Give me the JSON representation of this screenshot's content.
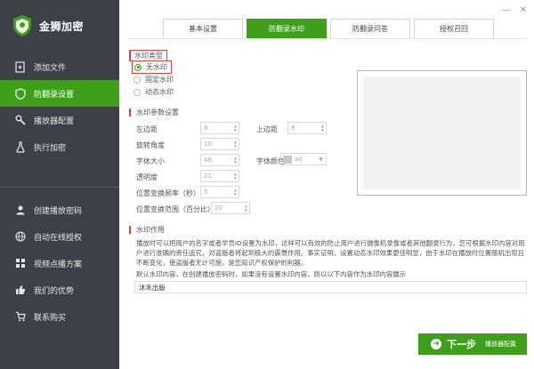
{
  "app": {
    "title": "金狮加密"
  },
  "window": {
    "min": "—",
    "close": "✕"
  },
  "sidebar": {
    "items": [
      {
        "label": "添加文件",
        "icon": "file-add-icon",
        "active": false
      },
      {
        "label": "防翻录设置",
        "icon": "shield-icon",
        "active": true
      },
      {
        "label": "播放器配置",
        "icon": "wrench-icon",
        "active": false
      },
      {
        "label": "执行加密",
        "icon": "flask-icon",
        "active": false
      }
    ],
    "items2": [
      {
        "label": "创建播放密码",
        "icon": "user-key-icon"
      },
      {
        "label": "自动在线授权",
        "icon": "globe-icon"
      },
      {
        "label": "视频点播方案",
        "icon": "grid-icon"
      },
      {
        "label": "我们的优势",
        "icon": "thumbs-up-icon"
      },
      {
        "label": "联系购买",
        "icon": "cart-icon"
      }
    ]
  },
  "tabs": [
    {
      "label": "基本设置",
      "active": false
    },
    {
      "label": "防翻录水印",
      "active": true
    },
    {
      "label": "防翻录问答",
      "active": false
    },
    {
      "label": "授权召回",
      "active": false
    }
  ],
  "watermark_type": {
    "title": "水印类型",
    "options": [
      {
        "label": "无水印",
        "checked": true
      },
      {
        "label": "固定水印",
        "checked": false
      },
      {
        "label": "动态水印",
        "checked": false
      }
    ]
  },
  "params": {
    "title": "水印参数设置",
    "left_margin_label": "左边距",
    "left_margin_value": "8",
    "top_margin_label": "上边距",
    "top_margin_value": "8",
    "rotation_label": "旋转角度",
    "rotation_value": "10",
    "font_size_label": "字体大小",
    "font_size_value": "46",
    "font_color_label": "字体颜色",
    "font_color_value": "ad",
    "opacity_label": "透明度",
    "opacity_value": "21",
    "freq_label": "位置变换频率（秒）",
    "freq_value": "5",
    "range_label": "位置变换范围（百分比）",
    "range_value": "20"
  },
  "usage": {
    "title": "水印作用",
    "description": "播放时可以把用户的名字或者学员ID设置为水印，这样可以有效的防止用户进行摄像机录像或者其他翻录行为，您可根据水印内容对用户进行准确的责任追究，对盗版者将起到极大的震慑作用。事实证明，设置动态水印效果更佳明显，由于水印在播放时位置随机出现且不断变化，使盗版者无计可施，是您知识产权保护的利器。",
    "default_note": "默认水印内容，在创建播放密码时，如果没有设置水印内容，则以以下内容作为水印内容展示",
    "default_value": "沐禾出版"
  },
  "next": {
    "label": "下一步",
    "sub": "播放器配置"
  },
  "colors": {
    "accent": "#3ea01a",
    "sidebar": "#3d4147",
    "highlight": "#e43d3d"
  }
}
